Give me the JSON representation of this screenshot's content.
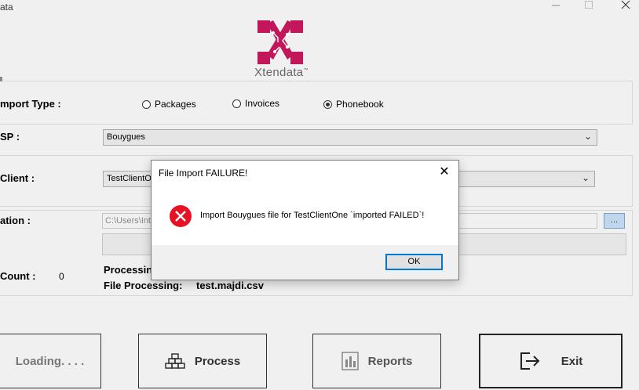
{
  "window": {
    "title": "ata",
    "minimize_icon": "minimize-icon",
    "maximize_icon": "maximize-icon",
    "close_icon": "close-icon"
  },
  "logo": {
    "brand_text": "Xtendata",
    "tm": "™",
    "color": "#c2185b"
  },
  "import_type": {
    "label": "mport Type :",
    "options": [
      {
        "label": "Packages",
        "selected": false
      },
      {
        "label": "Invoices",
        "selected": false
      },
      {
        "label": "Phonebook",
        "selected": true
      }
    ]
  },
  "isp": {
    "label": "SP :",
    "value": "Bouygues"
  },
  "client": {
    "label": "Client :",
    "value": "TestClientOne"
  },
  "location": {
    "label": "ation  :",
    "path": "C:\\Users\\Int",
    "browse_label": "..."
  },
  "stats": {
    "count_label": "Count :",
    "count_value": "0",
    "processing_label": "Processing",
    "file_processing_label": "File Processing:",
    "file_processing_value": "test.majdi.csv"
  },
  "buttons": {
    "loading": "Loading. . . .",
    "process": "Process",
    "reports": "Reports",
    "exit": "Exit"
  },
  "dialog": {
    "title": "File Import FAILURE!",
    "close": "✕",
    "message": "Import Bouygues file for TestClientOne `imported FAILED`!",
    "ok_label": "OK",
    "error_color": "#e81123"
  }
}
